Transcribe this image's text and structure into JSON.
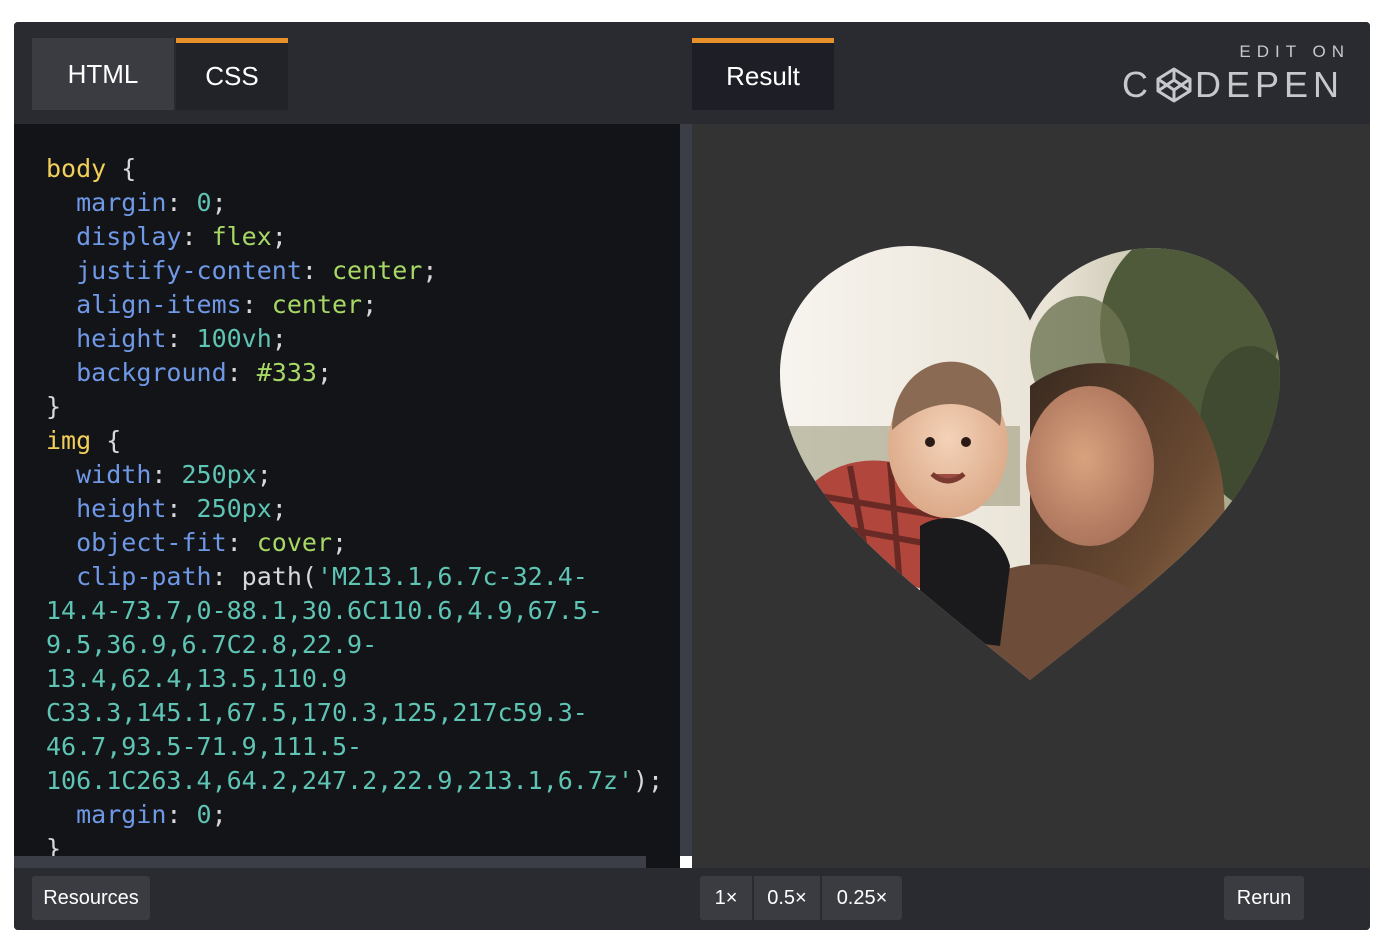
{
  "tabs": {
    "html": "HTML",
    "css": "CSS",
    "result": "Result"
  },
  "brand": {
    "edit_on": "EDIT ON",
    "name_left": "C",
    "name_right": "DEPEN"
  },
  "code_lines": [
    [
      [
        "sel",
        "body"
      ],
      [
        "punc",
        " {"
      ]
    ],
    [
      [
        "punc",
        "  "
      ],
      [
        "prop",
        "margin"
      ],
      [
        "punc",
        ": "
      ],
      [
        "num",
        "0"
      ],
      [
        "punc",
        ";"
      ]
    ],
    [
      [
        "punc",
        "  "
      ],
      [
        "prop",
        "display"
      ],
      [
        "punc",
        ": "
      ],
      [
        "val",
        "flex"
      ],
      [
        "punc",
        ";"
      ]
    ],
    [
      [
        "punc",
        "  "
      ],
      [
        "prop",
        "justify-content"
      ],
      [
        "punc",
        ": "
      ],
      [
        "val",
        "center"
      ],
      [
        "punc",
        ";"
      ]
    ],
    [
      [
        "punc",
        "  "
      ],
      [
        "prop",
        "align-items"
      ],
      [
        "punc",
        ": "
      ],
      [
        "val",
        "center"
      ],
      [
        "punc",
        ";"
      ]
    ],
    [
      [
        "punc",
        "  "
      ],
      [
        "prop",
        "height"
      ],
      [
        "punc",
        ": "
      ],
      [
        "num",
        "100vh"
      ],
      [
        "punc",
        ";"
      ]
    ],
    [
      [
        "punc",
        "  "
      ],
      [
        "prop",
        "background"
      ],
      [
        "punc",
        ": "
      ],
      [
        "val",
        "#333"
      ],
      [
        "punc",
        ";"
      ]
    ],
    [
      [
        "punc",
        "}"
      ]
    ],
    [
      [
        "sel",
        "img"
      ],
      [
        "punc",
        " {"
      ]
    ],
    [
      [
        "punc",
        "  "
      ],
      [
        "prop",
        "width"
      ],
      [
        "punc",
        ": "
      ],
      [
        "num",
        "250px"
      ],
      [
        "punc",
        ";"
      ]
    ],
    [
      [
        "punc",
        "  "
      ],
      [
        "prop",
        "height"
      ],
      [
        "punc",
        ": "
      ],
      [
        "num",
        "250px"
      ],
      [
        "punc",
        ";"
      ]
    ],
    [
      [
        "punc",
        "  "
      ],
      [
        "prop",
        "object-fit"
      ],
      [
        "punc",
        ": "
      ],
      [
        "val",
        "cover"
      ],
      [
        "punc",
        ";"
      ]
    ],
    [
      [
        "punc",
        "  "
      ],
      [
        "prop",
        "clip-path"
      ],
      [
        "punc",
        ": path("
      ],
      [
        "str",
        "'M213.1,6.7c-32.4-"
      ]
    ],
    [
      [
        "str",
        "14.4-73.7,0-88.1,30.6C110.6,4.9,67.5-"
      ]
    ],
    [
      [
        "str",
        "9.5,36.9,6.7C2.8,22.9-"
      ]
    ],
    [
      [
        "str",
        "13.4,62.4,13.5,110.9"
      ]
    ],
    [
      [
        "str",
        "C33.3,145.1,67.5,170.3,125,217c59.3-"
      ]
    ],
    [
      [
        "str",
        "46.7,93.5-71.9,111.5-"
      ]
    ],
    [
      [
        "str",
        "106.1C263.4,64.2,247.2,22.9,213.1,6.7z'"
      ],
      [
        "punc",
        ");"
      ]
    ],
    [
      [
        "punc",
        "  "
      ],
      [
        "prop",
        "margin"
      ],
      [
        "punc",
        ": "
      ],
      [
        "num",
        "0"
      ],
      [
        "punc",
        ";"
      ]
    ],
    [
      [
        "punc",
        "}"
      ]
    ]
  ],
  "result": {
    "image": "heart-clipped-photo"
  },
  "footer": {
    "resources": "Resources",
    "zoom_1": "1×",
    "zoom_05": "0.5×",
    "zoom_025": "0.25×",
    "rerun": "Rerun"
  },
  "colors": {
    "accent": "#e8912b",
    "selector": "#f1cf5a",
    "property": "#6f98e6",
    "value": "#a7d866",
    "number": "#5ec4b4"
  }
}
